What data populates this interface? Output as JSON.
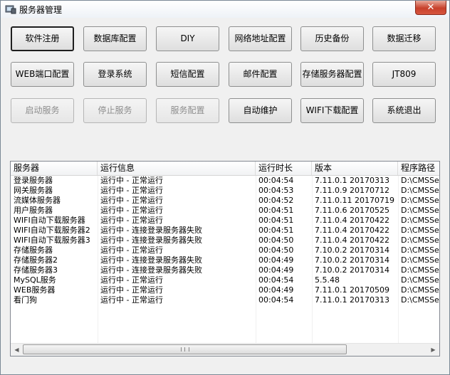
{
  "window": {
    "title": "服务器管理",
    "close_label": "✕"
  },
  "buttons": {
    "row1": [
      "软件注册",
      "数据库配置",
      "DIY",
      "网络地址配置",
      "历史备份",
      "数据迁移"
    ],
    "row2": [
      "WEB端口配置",
      "登录系统",
      "短信配置",
      "邮件配置",
      "存储服务器配置",
      "JT809"
    ],
    "row3": [
      "启动服务",
      "停止服务",
      "服务配置",
      "自动维护",
      "WIFI下载配置",
      "系统退出"
    ]
  },
  "table": {
    "columns": [
      "服务器",
      "运行信息",
      "运行时长",
      "版本",
      "程序路径"
    ],
    "rows": [
      [
        "登录服务器",
        "运行中 - 正常运行",
        "00:04:54",
        "7.11.0.1 20170313",
        "D:\\CMSSer"
      ],
      [
        "网关服务器",
        "运行中 - 正常运行",
        "00:04:53",
        "7.11.0.9 20170712",
        "D:\\CMSSer"
      ],
      [
        "流媒体服务器",
        "运行中 - 正常运行",
        "00:04:52",
        "7.11.0.11 20170719",
        "D:\\CMSSer"
      ],
      [
        "用户服务器",
        "运行中 - 正常运行",
        "00:04:51",
        "7.11.0.6 20170525",
        "D:\\CMSSer"
      ],
      [
        "WIFI自动下载服务器",
        "运行中 - 正常运行",
        "00:04:51",
        "7.11.0.4 20170422",
        "D:\\CMSSer"
      ],
      [
        "WIFI自动下载服务器2",
        "运行中 - 连接登录服务器失败",
        "00:04:51",
        "7.11.0.4 20170422",
        "D:\\CMSSer"
      ],
      [
        "WIFI自动下载服务器3",
        "运行中 - 连接登录服务器失败",
        "00:04:50",
        "7.11.0.4 20170422",
        "D:\\CMSSer"
      ],
      [
        "存储服务器",
        "运行中 - 正常运行",
        "00:04:50",
        "7.10.0.2 20170314",
        "D:\\CMSSer"
      ],
      [
        "存储服务器2",
        "运行中 - 连接登录服务器失败",
        "00:04:49",
        "7.10.0.2 20170314",
        "D:\\CMSSer"
      ],
      [
        "存储服务器3",
        "运行中 - 连接登录服务器失败",
        "00:04:49",
        "7.10.0.2 20170314",
        "D:\\CMSSer"
      ],
      [
        "MySQL服务",
        "运行中 - 正常运行",
        "00:04:54",
        "5.5.48",
        "D:\\CMSSer"
      ],
      [
        "WEB服务器",
        "运行中 - 正常运行",
        "00:04:49",
        "7.11.0.1 20170509",
        "D:\\CMSSer"
      ],
      [
        "看门狗",
        "运行中 - 正常运行",
        "00:04:54",
        "7.11.0.1 20170313",
        "D:\\CMSSer"
      ]
    ]
  },
  "scrollbar": {
    "left_arrow_icon": "arrow-left-icon",
    "right_arrow_icon": "arrow-right-icon"
  }
}
